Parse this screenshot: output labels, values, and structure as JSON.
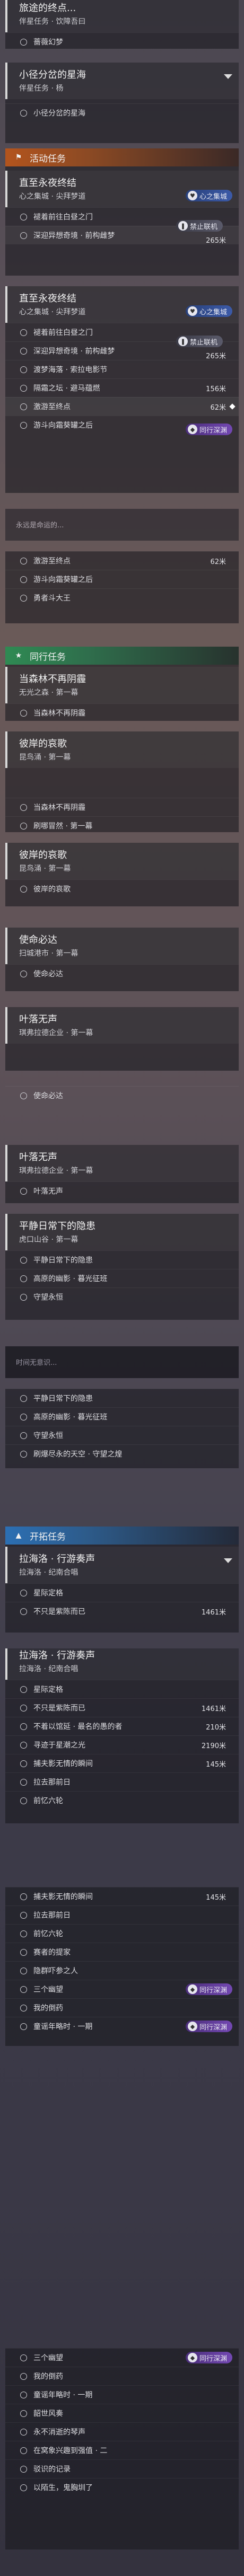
{
  "quest_top": {
    "title": "旅途的终点...",
    "subtitle": "伴星任务 · 饮障吾曰",
    "step": "蔷薇幻梦"
  },
  "quest_star": {
    "title": "小径分岔的星海",
    "subtitle": "伴星任务 · 杨",
    "step": "小径分岔的星海"
  },
  "sections": {
    "event": "活动任务",
    "companion": "同行任务",
    "trailblaze": "开拓任务"
  },
  "badges": {
    "heart": "心之集城",
    "pause": "禁止联机",
    "instance": "同行深渊"
  },
  "bg_scroll": {
    "ticker_a": "永远是命运的...",
    "ticker_b": "时间无意识..."
  },
  "event_quest": {
    "title": "直至永夜终结",
    "subtitle": "心之集城 · 尖拜梦道",
    "steps": [
      {
        "label": "褪着前往白昼之门",
        "dist": ""
      },
      {
        "label": "深迎异想奇境 · 前构雌梦",
        "dist": "265米"
      }
    ]
  },
  "event_quest_2": {
    "title": "直至永夜终结",
    "subtitle": "心之集城 · 尖拜梦道",
    "steps": [
      {
        "label": "褪着前往白昼之门",
        "dist": ""
      },
      {
        "label": "深迎异想奇境 · 前构雌梦",
        "dist": "265米"
      },
      {
        "label": "渡梦海落 · 索拉电影节",
        "dist": ""
      },
      {
        "label": "隔霜之坛 · 避马蕴燃",
        "dist": "156米"
      },
      {
        "label": "激游至终点",
        "dist": "62米"
      },
      {
        "label": "游斗向霜葵罐之后",
        "dist": ""
      }
    ]
  },
  "event_tail": {
    "steps": [
      {
        "label": "激游至终点",
        "dist": "62米"
      },
      {
        "label": "游斗向霜葵罐之后",
        "dist": ""
      },
      {
        "label": "勇者斗大王",
        "dist": ""
      }
    ]
  },
  "companion_quests": [
    {
      "title": "当森林不再阴霾",
      "subtitle": "无光之森 · 第一幕",
      "step": "当森林不再阴霾"
    },
    {
      "title": "彼岸的哀歌",
      "subtitle": "昆鸟涌 · 第一幕",
      "steps": [
        "当森林不再阴霾",
        "刷哪冒然 · 第一幕"
      ]
    },
    {
      "title": "彼岸的哀歌",
      "subtitle": "昆鸟涌 · 第一幕",
      "step": "彼岸的哀歌"
    },
    {
      "title": "使命必达",
      "subtitle": "扫城港市 · 第一幕",
      "step": "使命必达"
    },
    {
      "title": "叶落无声",
      "subtitle": "琪弗拉德企业 · 第一幕",
      "step": "使命必达"
    },
    {
      "title": "叶落无声",
      "subtitle": "琪弗拉德企业 · 第一幕",
      "step": "叶落无声"
    },
    {
      "title": "平静日常下的隐患",
      "subtitle": "虎口山谷 · 第一幕",
      "steps": [
        "平静日常下的隐患",
        "高原的幽影 · 暮光征班",
        "守望永恒"
      ]
    }
  ],
  "companion_tail": {
    "steps": [
      "平静日常下的隐患",
      "高原的幽影 · 暮光征班",
      "守望永恒",
      "刷爆尽永的天空 · 守望之煌"
    ]
  },
  "trailblaze_quest": {
    "title": "拉海洛 · 行游奏声",
    "subtitle": "拉海洛 · 纪南合唱",
    "steps": [
      {
        "label": "星际定格",
        "dist": ""
      },
      {
        "label": "不只是紫陈而已",
        "dist": "1461米"
      }
    ]
  },
  "trailblaze_quest_2": {
    "title": "拉海洛 · 行游奏声",
    "subtitle": "拉海洛 · 纪南合唱",
    "steps": [
      {
        "label": "星际定格",
        "dist": ""
      },
      {
        "label": "不只是紫陈而已",
        "dist": "1461米"
      },
      {
        "label": "不着以馆延 · 最名的愚的者",
        "dist": "210米"
      },
      {
        "label": "寻迹于星潮之光",
        "dist": "2190米"
      },
      {
        "label": "捕夫影无情的瞬间",
        "dist": "145米"
      },
      {
        "label": "拉去那前日",
        "dist": ""
      },
      {
        "label": "前忆六轮",
        "dist": ""
      }
    ]
  },
  "trailblaze_tail": {
    "steps": [
      {
        "label": "捕夫影无情的瞬间",
        "dist": "145米"
      },
      {
        "label": "拉去那前日",
        "dist": ""
      },
      {
        "label": "前忆六轮",
        "dist": ""
      },
      {
        "label": "赛者的提家",
        "dist": ""
      },
      {
        "label": "隐群吓参之人",
        "dist": ""
      },
      {
        "label": "三个幽望",
        "dist": ""
      },
      {
        "label": "我的倒药",
        "dist": ""
      },
      {
        "label": "童谣年略时 · 一期",
        "dist": ""
      }
    ]
  },
  "final_list": {
    "steps": [
      "三个幽望",
      "我的倒药",
      "童谣年略时 · 一期",
      "韶世风奏",
      "永不消逝的琴声",
      "在窝象兴趣到强值 · 二",
      "驳识的记录",
      "以陌生，鬼胸圳了"
    ]
  }
}
